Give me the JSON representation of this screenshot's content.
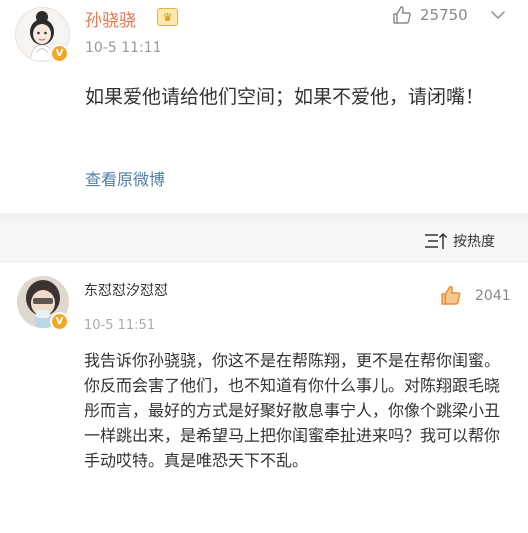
{
  "post": {
    "author": "孙骁骁",
    "time": "10-5 11:11",
    "like_count": "25750",
    "content": "如果爱他请给他们空间；如果不爱他，请闭嘴！",
    "view_original": "查看原微博"
  },
  "sort": {
    "label": "按热度"
  },
  "comment": {
    "author": "东怼怼汐怼怼",
    "time": "10-5 11:51",
    "like_count": "2041",
    "content": "我告诉你孙骁骁，你这不是在帮陈翔，更不是在帮你闺蜜。你反而会害了他们，也不知道有你什么事儿。对陈翔跟毛晓彤而言，最好的方式是好聚好散息事宁人，你像个跳梁小丑一样跳出来，是希望马上把你闺蜜牵扯进来吗？我可以帮你手动哎特。真是唯恐天下不乱。"
  },
  "colors": {
    "name_orange": "#eb7350",
    "link_blue": "#507daf",
    "like_orange": "#f0883a",
    "badge_yellow": "#f5a623"
  },
  "icons": {
    "thumbs_up": "thumbs-up-icon",
    "chevron": "chevron-down-icon",
    "sort": "sort-icon",
    "verified": "verified-badge-icon",
    "member": "crown-icon"
  }
}
